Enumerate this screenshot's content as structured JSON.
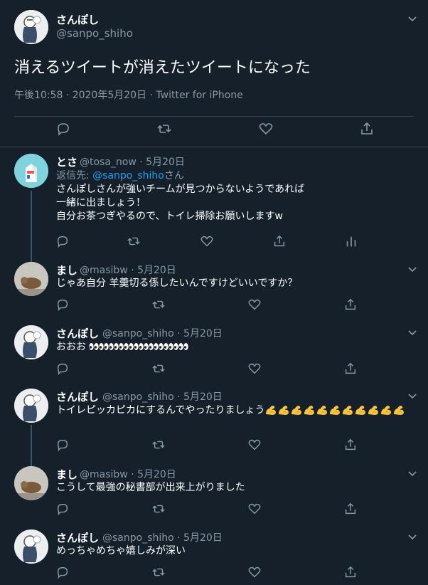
{
  "main_tweet": {
    "author_name": "さんぽし",
    "author_handle": "@sanpo_shiho",
    "text": "消えるツイートが消えたツイートになった",
    "timestamp": "午後10:58 · 2020年5月20日 · Twitter for iPhone",
    "actions": [
      "reply-icon",
      "retweet-icon",
      "like-icon",
      "share-icon"
    ]
  },
  "replies": [
    {
      "author_name": "とさ",
      "meta": "@tosa_now · 5月20日",
      "reply_to_prefix": "返信先: ",
      "reply_to_handle": "@sanpo_shiho",
      "reply_to_suffix": "さん",
      "lines": [
        "さんぽしさんが強いチームが見つからないようであれば",
        "一緒に出ましょう！",
        "自分お茶つぎやるので、トイレ掃除お願いしますw"
      ],
      "actions": [
        "reply-icon",
        "retweet-icon",
        "like-icon",
        "share-icon",
        "analytics-icon"
      ]
    },
    {
      "author_name": "まし",
      "meta": "@masibw · 5月20日",
      "lines": [
        "じゃあ自分 羊羹切る係したいんですけどいいですか？"
      ]
    },
    {
      "author_name": "さんぽし",
      "meta": "@sanpo_shiho · 5月20日",
      "lines": [
        "おおお"
      ],
      "emoji": {
        "name": "eyes-emoji",
        "count": 10
      }
    },
    {
      "author_name": "さんぽし",
      "meta": "@sanpo_shiho · 5月20日",
      "lines": [
        "トイレピッカピカにするんでやったりましょう"
      ],
      "emoji": {
        "name": "flexed-biceps-emoji",
        "count": 11
      }
    },
    {
      "author_name": "まし",
      "meta": "@masibw · 5月20日",
      "lines": [
        "こうして最強の秘書部が出来上がりました"
      ]
    },
    {
      "author_name": "さんぽし",
      "meta": "@sanpo_shiho · 5月20日",
      "lines": [
        "めっちゃめちゃ嬉しみが深い"
      ]
    }
  ],
  "colors": {
    "background": "#15202b",
    "border": "#38444d",
    "secondary_text": "#8899a6",
    "link": "#1da1f2",
    "thread_line": "#3d5466"
  }
}
